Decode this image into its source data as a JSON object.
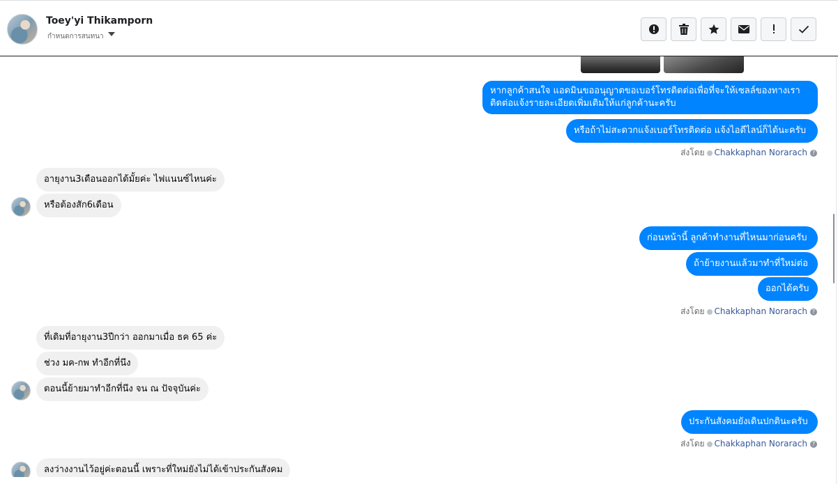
{
  "header": {
    "contact_name": "Toey'yi Thikamporn",
    "conversation_menu_label": "กำหนดการสนทนา",
    "toolbar": {
      "icons": [
        "alert-circle-icon",
        "trash-icon",
        "star-icon",
        "envelope-icon",
        "exclamation-icon",
        "checkmark-icon"
      ]
    }
  },
  "messages": {
    "out_1a": "หากลูกค้าสนใจ แอดมินขออนุญาตขอเบอร์โทรติดต่อเพื่อที่จะให้เซลล์ของทางเรา",
    "out_1b": "ติดต่อแจ้งรายละเอียดเพิ่มเติมให้แก่ลูกค้านะครับ",
    "out_2": "หรือถ้าไม่สะดวกแจ้งเบอร์โทรติดต่อ แจ้งไอดีไลน์ก็ได้นะครับ",
    "in_1": "อายุงาน3เดือนออกได้มั้ยค่ะ ไฟแนนซ์ไหนค่ะ",
    "in_2": "หรือต้องสัก6เดือน",
    "out_3": "ก่อนหน้านี้ ลูกค้าทำงานที่ไหนมาก่อนครับ",
    "out_4": "ถ้าย้ายงานแล้วมาทำที่ใหม่ต่อ",
    "out_5": "ออกได้ครับ",
    "in_3": "ที่เดิมที่อายุงาน3ปีกว่า ออกมาเมื่อ ธค 65 ค่ะ",
    "in_4": "ช่วง มค-กพ ทำอีกที่นึง",
    "in_5": "ตอนนี้ย้ายมาทำอีกที่นึง จน ณ ปัจจุบันค่ะ",
    "out_6": "ประกันสังคมยังเดินปกตินะครับ",
    "in_6": "ลงว่างงานไว้อยู่ค่ะตอนนี้ เพราะที่ใหม่ยังไม่ได้เข้าประกันสังคม"
  },
  "sent_by": {
    "prefix": "ส่งโดย",
    "agent": "Chakkaphan Norarach",
    "help": "?"
  },
  "colors": {
    "outgoing_bubble": "#0084ff",
    "incoming_bubble": "#f0f0f0",
    "agent_link": "#385898"
  }
}
